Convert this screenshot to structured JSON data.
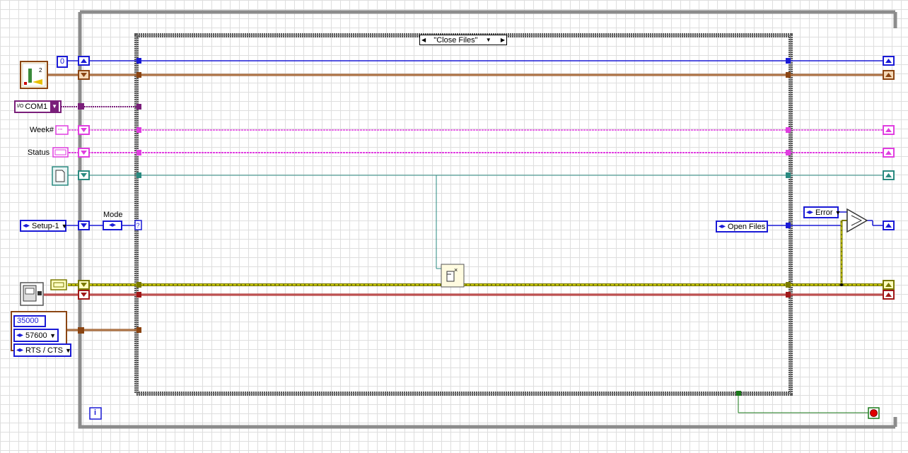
{
  "case_structure": {
    "selector_value": "\"Close Files\"",
    "decrement_glyph": "◀",
    "increment_glyph": "▶",
    "dropdown_glyph": "▼"
  },
  "constants": {
    "index_zero": "0",
    "visa_resource": "COM1",
    "visa_prefix": "I/O",
    "setup_enum": "Setup-1",
    "open_files_enum": "Open Files",
    "error_enum": "Error",
    "mode_label": "Mode"
  },
  "labels": {
    "week": "Week#",
    "status": "Status"
  },
  "serial_cluster": {
    "timeout": "35000",
    "baud": "57600",
    "flow": "RTS / CTS"
  },
  "loop": {
    "iteration_terminal": "i"
  },
  "colors": {
    "loop_border": "#8c8c8c",
    "blue_wire": "#1a1ad6",
    "brown_wire": "#8b4513",
    "purple_wire": "#7a1f7a",
    "pink_wire": "#e03ee0",
    "teal_wire": "#2a8a80",
    "error_wire": "#c8c800",
    "red_wire": "#a01818",
    "stop_red": "#e00000"
  },
  "icons": {
    "sequence_icon": "sequence-subvi-icon",
    "file_ref_icon": "file-refnum-icon",
    "close_file_icon": "close-file-icon",
    "select_icon": "select-primitive-icon",
    "stop_icon": "stop-terminal-icon"
  }
}
